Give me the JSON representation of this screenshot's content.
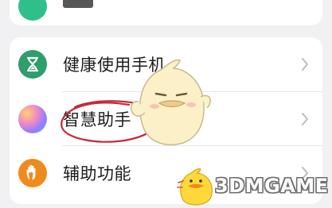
{
  "settings_list": {
    "items": [
      {
        "label": "健康使用手机",
        "icon": "hourglass-icon",
        "icon_color": "#2e9e6b"
      },
      {
        "label": "智慧助手",
        "icon": "smart-assistant-gradient-icon",
        "icon_color": "#e86aa6"
      },
      {
        "label": "辅助功能",
        "icon": "hand-icon",
        "icon_color": "#f08a1c"
      }
    ]
  },
  "top_item": {
    "icon": "top-item-icon",
    "icon_color": "#2fbf8a"
  },
  "watermark": {
    "text": "3DMGAME"
  },
  "colors": {
    "accent_circle": "#c8283a",
    "background": "#f1f1f3"
  }
}
